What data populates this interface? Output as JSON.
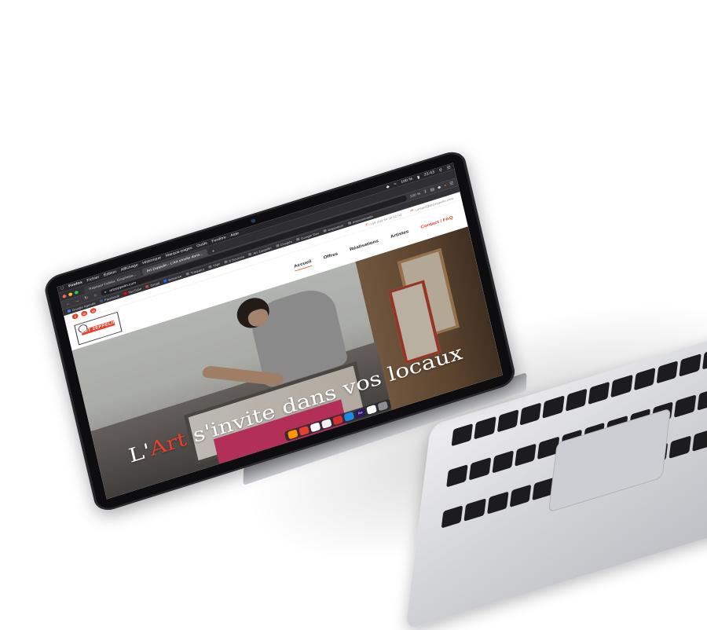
{
  "menubar": {
    "app": "Firefox",
    "items": [
      "Fichier",
      "Édition",
      "Affichage",
      "Historique",
      "Marque-pages",
      "Outils",
      "Fenêtre",
      "Aide"
    ],
    "battery": "100 %",
    "time": "23:43"
  },
  "browser": {
    "tabs": [
      {
        "label": "Raphael Dobler, Graphiste..."
      },
      {
        "label": "Art Zeppelin - L'Art s'invite dans..."
      }
    ],
    "new_tab": "+",
    "url": "artzeppelin.com",
    "zoom": "100 %",
    "bookmarks": [
      "Google Agenda",
      "Facebook",
      "YouTube",
      "Gmail",
      "Behance",
      "Traqueur",
      "TNP",
      "5 Sources",
      "Art Zeppelin",
      "Congés",
      "Google Dev",
      "Inspiration",
      "Instrumentale"
    ]
  },
  "site": {
    "social": [
      "f",
      "in",
      "yt"
    ],
    "phone": "+33 (0)9 54 30 62 02",
    "email": "contact@artzeppelin.com",
    "logo_text": "ART ZEPPELIN",
    "nav": [
      {
        "label": "Accueil"
      },
      {
        "label": "Offres"
      },
      {
        "label": "Réalisations"
      },
      {
        "label": "Artistes"
      },
      {
        "label": "Contact / FAQ"
      }
    ],
    "hero": {
      "prefix": "L'",
      "accent": "Art",
      "rest": " s'invite dans vos locaux"
    }
  },
  "dock": [
    "Ae"
  ],
  "colors": {
    "accent": "#e8412b",
    "menubar": "#26262a",
    "chrome": "#38383d"
  }
}
